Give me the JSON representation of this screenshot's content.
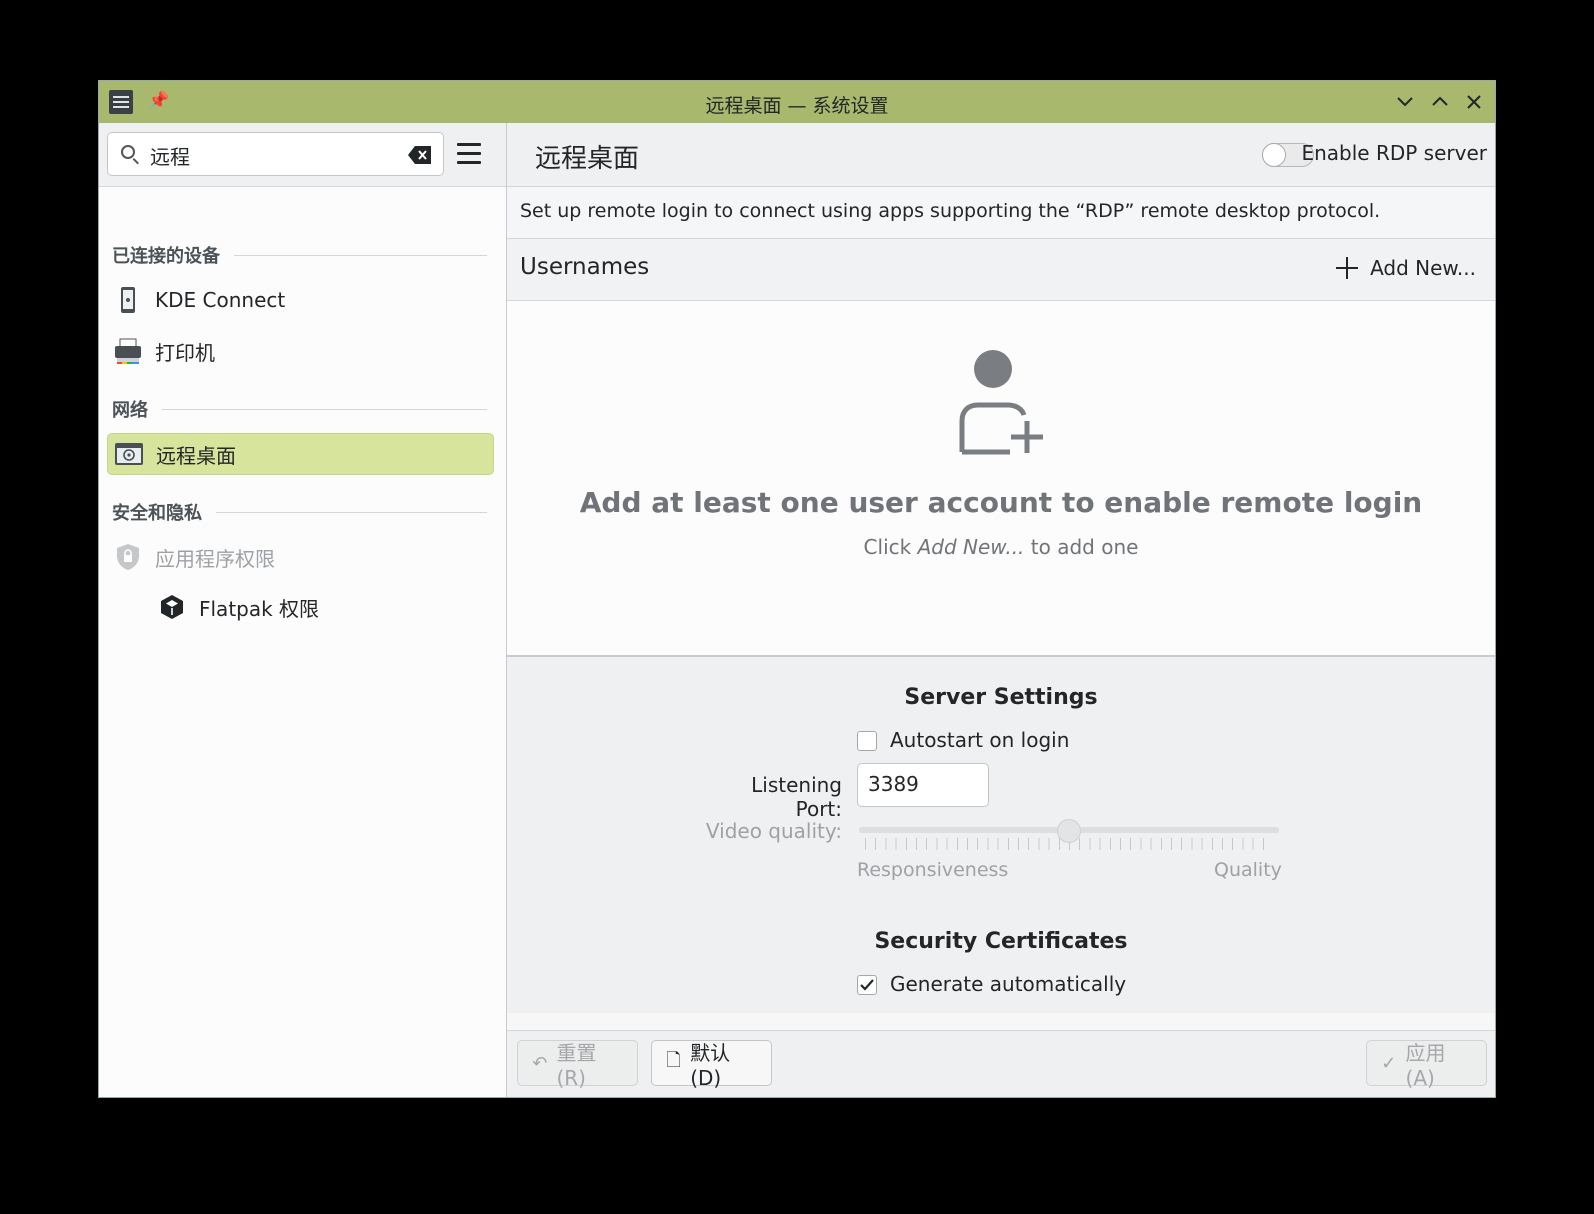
{
  "window": {
    "title": "远程桌面 — 系统设置"
  },
  "sidebar": {
    "search": {
      "value": "远程"
    },
    "sections": [
      {
        "header": "已连接的设备"
      },
      {
        "header": "网络"
      },
      {
        "header": "安全和隐私"
      }
    ],
    "items": [
      {
        "label": "KDE Connect",
        "icon": "phone-icon"
      },
      {
        "label": "打印机",
        "icon": "printer-icon"
      },
      {
        "label": "远程桌面",
        "icon": "remote-desktop-icon",
        "active": true
      },
      {
        "label": "应用程序权限",
        "icon": "shield-lock-icon",
        "disabled": true
      },
      {
        "label": "Flatpak 权限",
        "icon": "flatpak-icon"
      }
    ]
  },
  "main": {
    "title": "远程桌面",
    "rdp_toggle_label": "Enable RDP server",
    "description": "Set up remote login to connect using apps supporting the “RDP” remote desktop protocol.",
    "usernames_label": "Usernames",
    "add_new_label": "Add New...",
    "empty_title": "Add at least one user account to enable remote login",
    "empty_sub_prefix": "Click ",
    "empty_sub_em": "Add New...",
    "empty_sub_suffix": " to add one",
    "server_settings": {
      "title": "Server Settings",
      "autostart_label": "Autostart on login",
      "autostart_checked": false,
      "port_label": "Listening Port:",
      "port_value": "3389",
      "video_quality_label": "Video quality:",
      "video_quality_value": 0.5,
      "range_low": "Responsiveness",
      "range_high": "Quality"
    },
    "security": {
      "title": "Security Certificates",
      "generate_label": "Generate automatically",
      "generate_checked": true
    }
  },
  "footer": {
    "reset_label": "重置(R)",
    "defaults_label": "默认(D)",
    "apply_label": "应用(A)"
  },
  "colors": {
    "titlebar": "#a8b86c",
    "active_item": "#d7e49c"
  }
}
